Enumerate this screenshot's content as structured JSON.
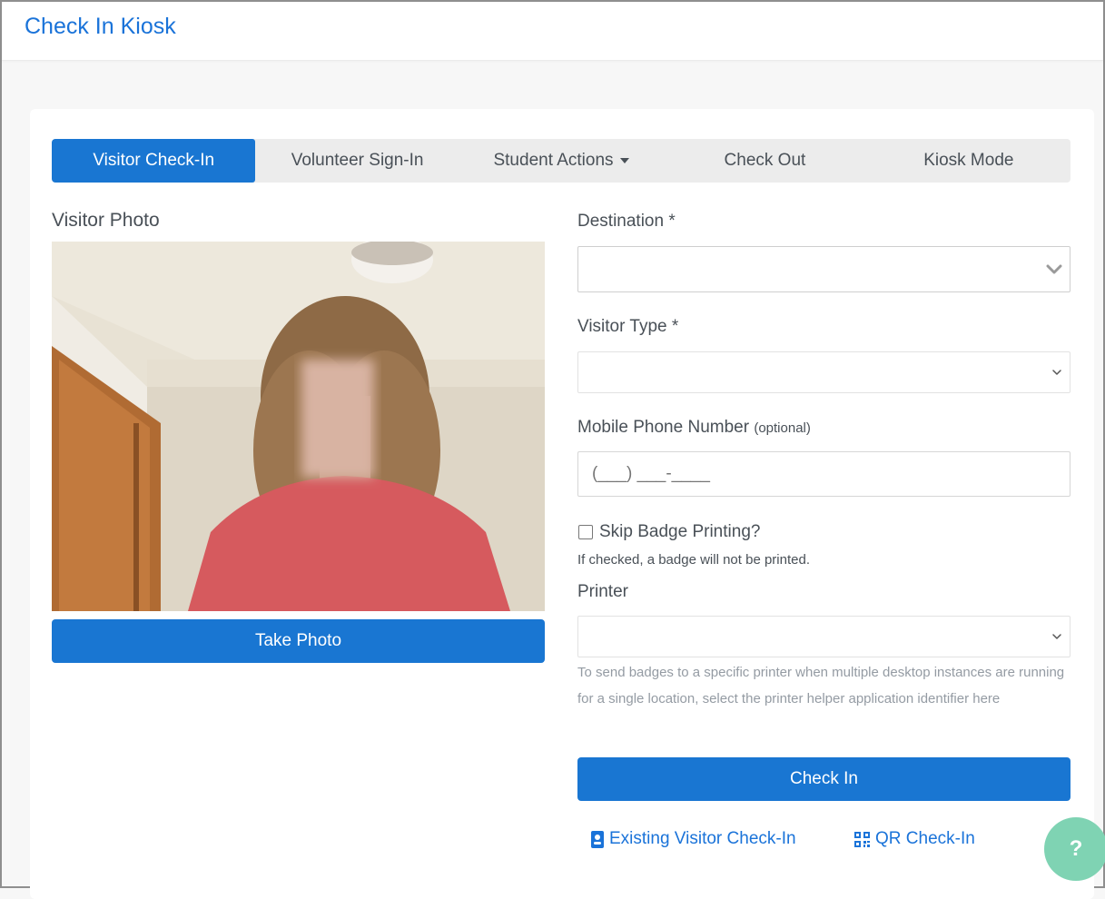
{
  "app": {
    "title": "Check In Kiosk"
  },
  "tabs": [
    {
      "label": "Visitor Check-In",
      "active": true
    },
    {
      "label": "Volunteer Sign-In",
      "active": false
    },
    {
      "label": "Student Actions",
      "active": false,
      "has_dropdown": true
    },
    {
      "label": "Check Out",
      "active": false
    },
    {
      "label": "Kiosk Mode",
      "active": false
    }
  ],
  "photo": {
    "label": "Visitor Photo",
    "take_photo_label": "Take Photo"
  },
  "form": {
    "destination": {
      "label": "Destination *",
      "value": ""
    },
    "visitor_type": {
      "label": "Visitor Type *",
      "value": ""
    },
    "phone": {
      "label": "Mobile Phone Number",
      "optional": "(optional)",
      "placeholder": "(___) ___-____"
    },
    "skip_badge": {
      "label": "Skip Badge Printing?",
      "checked": false,
      "help": "If checked, a badge will not be printed."
    },
    "printer": {
      "label": "Printer",
      "value": "",
      "help": "To send badges to a specific printer when multiple desktop instances are running for a single location, select the printer helper application identifier here"
    },
    "check_in_label": "Check In"
  },
  "links": {
    "existing_visitor": "Existing Visitor Check-In",
    "qr_checkin": "QR Check-In"
  },
  "help_fab": {
    "label": "?"
  },
  "colors": {
    "primary": "#1976d2",
    "link": "#1a73d9",
    "help_fab": "#7fd3b3"
  }
}
